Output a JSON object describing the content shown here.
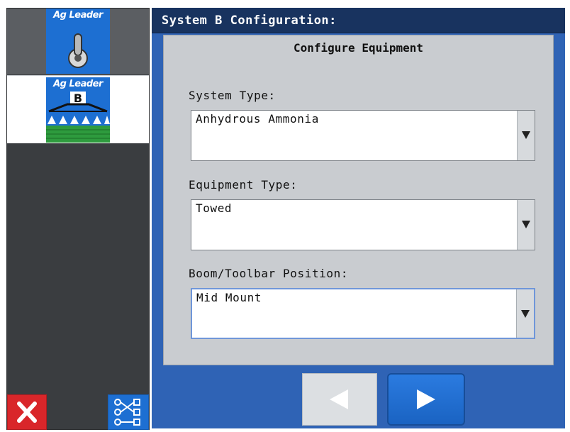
{
  "sidebar": {
    "items": [
      {
        "brand": "Ag Leader",
        "icon": "toggle-switch-icon",
        "selected": false
      },
      {
        "brand": "Ag Leader",
        "badge": "B",
        "icon": "sprayer-boom-icon",
        "selected": true
      }
    ],
    "bottom": {
      "cancel_icon": "close-x-icon",
      "cancel_color": "#d9262a",
      "connect_icon": "connection-diagram-icon"
    }
  },
  "window": {
    "title": "System B Configuration:"
  },
  "panel": {
    "heading": "Configure Equipment",
    "fields": [
      {
        "label": "System Type:",
        "value": "Anhydrous Ammonia"
      },
      {
        "label": "Equipment Type:",
        "value": "Towed"
      },
      {
        "label": "Boom/Toolbar Position:",
        "value": "Mid Mount"
      }
    ]
  },
  "nav": {
    "prev_icon": "left-arrow-icon",
    "next_icon": "right-arrow-icon"
  },
  "colors": {
    "title_bar": "#18335f",
    "accent_blue": "#1f6fd4",
    "panel_bg": "#c9ccd0"
  }
}
